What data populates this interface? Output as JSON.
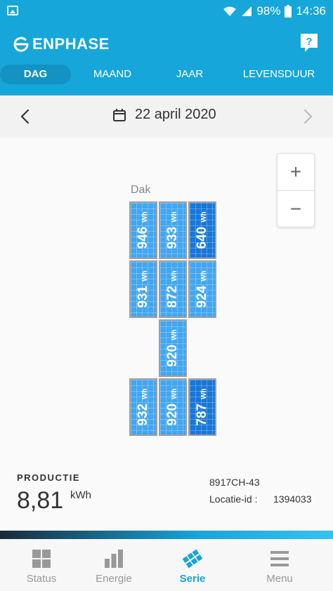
{
  "status_bar": {
    "battery": "98%",
    "time": "14:36"
  },
  "header": {
    "logo_text": "ENPHASE",
    "help_icon": "question-mark-icon"
  },
  "tabs": [
    {
      "label": "DAG",
      "active": true
    },
    {
      "label": "MAAND",
      "active": false
    },
    {
      "label": "JAAR",
      "active": false
    },
    {
      "label": "LEVENSDUUR",
      "active": false
    }
  ],
  "date_bar": {
    "date": "22 april 2020",
    "prev_icon": "chevron-left-icon",
    "next_icon": "chevron-right-icon",
    "calendar_icon": "calendar-icon"
  },
  "zoom": {
    "in_label": "+",
    "out_label": "−"
  },
  "array": {
    "label": "Dak",
    "unit": "Wh",
    "panels": [
      {
        "value": "946"
      },
      {
        "value": "933"
      },
      {
        "value": "640"
      },
      {
        "value": "931"
      },
      {
        "value": "872"
      },
      {
        "value": "924"
      },
      {
        "value": "920"
      },
      {
        "value": "932"
      },
      {
        "value": "920"
      },
      {
        "value": "787"
      }
    ]
  },
  "production": {
    "title": "PRODUCTIE",
    "value": "8,81",
    "unit": "kWh",
    "system_id": "8917CH-43",
    "location_label": "Locatie-id :",
    "location_id": "1394033"
  },
  "bottom_nav": [
    {
      "label": "Status",
      "icon": "grid-icon",
      "active": false
    },
    {
      "label": "Energie",
      "icon": "bar-chart-icon",
      "active": false
    },
    {
      "label": "Serie",
      "icon": "solar-panel-icon",
      "active": true
    },
    {
      "label": "Menu",
      "icon": "hamburger-menu-icon",
      "active": false
    }
  ],
  "colors": {
    "brand": "#16a6d9",
    "panel": "#42a6f0",
    "panel_low": "#1877d8"
  }
}
